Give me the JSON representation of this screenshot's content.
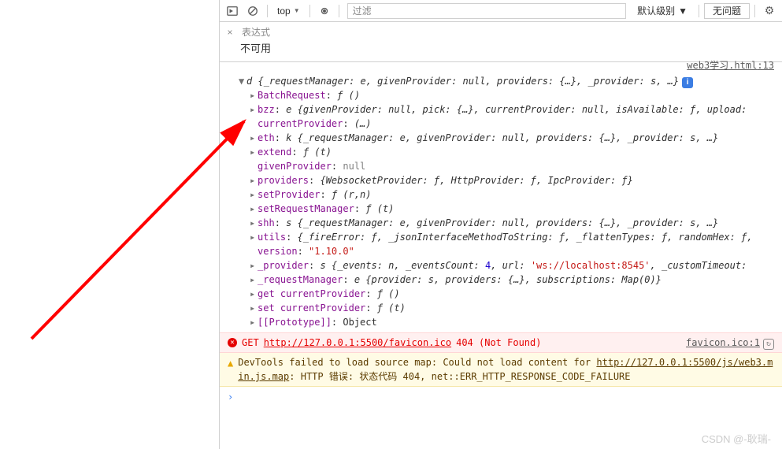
{
  "toolbar": {
    "context": "top",
    "filter_placeholder": "过滤",
    "level_label": "默认级别",
    "issues_label": "无问题"
  },
  "watch": {
    "title": "表达式",
    "na": "不可用"
  },
  "source_link": {
    "file": "web3学习.html",
    "line": "13"
  },
  "root": {
    "name": "d",
    "summary": "{_requestManager: e, givenProvider: null, providers: {…}, _provider: s, …}"
  },
  "props": [
    {
      "key": "BatchRequest",
      "type": "fn",
      "sig": "ƒ ()"
    },
    {
      "key": "bzz",
      "type": "obj",
      "val": "e {givenProvider: null, pick: {…}, currentProvider: null, isAvailable: ƒ, upload:"
    },
    {
      "key": "currentProvider",
      "type": "obj-noarrow",
      "val": "(…)"
    },
    {
      "key": "eth",
      "type": "obj",
      "val": "k {_requestManager: e, givenProvider: null, providers: {…}, _provider: s, …}"
    },
    {
      "key": "extend",
      "type": "fn",
      "sig": "ƒ (t)"
    },
    {
      "key": "givenProvider",
      "type": "null-noarrow",
      "val": "null"
    },
    {
      "key": "providers",
      "type": "obj",
      "val": "{WebsocketProvider: ƒ, HttpProvider: ƒ, IpcProvider: ƒ}"
    },
    {
      "key": "setProvider",
      "type": "fn",
      "sig": "ƒ (r,n)"
    },
    {
      "key": "setRequestManager",
      "type": "fn",
      "sig": "ƒ (t)"
    },
    {
      "key": "shh",
      "type": "obj",
      "val": "s {_requestManager: e, givenProvider: null, providers: {…}, _provider: s, …}"
    },
    {
      "key": "utils",
      "type": "obj",
      "val": "{_fireError: ƒ, _jsonInterfaceMethodToString: ƒ, _flattenTypes: ƒ, randomHex: ƒ,"
    },
    {
      "key": "version",
      "type": "str-noarrow",
      "val": "\"1.10.0\""
    },
    {
      "key": "_provider",
      "type": "mixed",
      "prefix": "s {_events: n, _eventsCount: ",
      "num": "4",
      "mid": ", url: ",
      "str": "'ws://localhost:8545'",
      "suffix": ", _customTimeout:"
    },
    {
      "key": "_requestManager",
      "type": "obj",
      "val": "e {provider: s, providers: {…}, subscriptions: Map(0)}"
    },
    {
      "key": "get currentProvider",
      "type": "fn",
      "sig": "ƒ ()"
    },
    {
      "key": "set currentProvider",
      "type": "fn",
      "sig": "ƒ (t)"
    },
    {
      "key": "[[Prototype]]",
      "type": "plain",
      "val": "Object"
    }
  ],
  "error": {
    "method": "GET",
    "url": "http://127.0.0.1:5500/favicon.ico",
    "status": "404 (Not Found)",
    "src_file": "favicon.ico",
    "src_line": "1"
  },
  "warn": {
    "pre": "DevTools failed to load source map: Could not load content for ",
    "url": "http://127.0.0.1:5500/js/web3.min.js.map",
    "post": ": HTTP 错误: 状态代码 404, net::ERR_HTTP_RESPONSE_CODE_FAILURE"
  },
  "watermark": "CSDN @-耿瑞-"
}
